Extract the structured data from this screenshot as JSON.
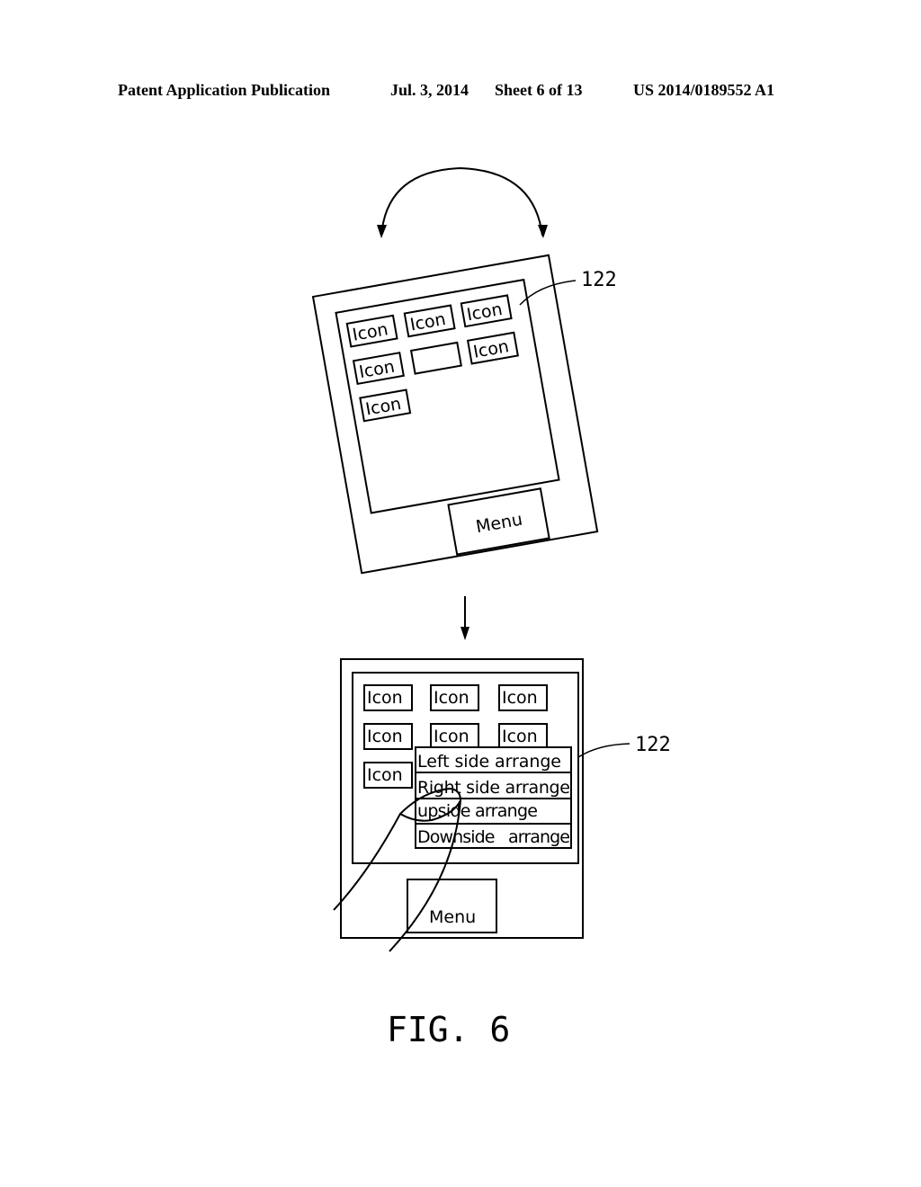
{
  "header": {
    "publication": "Patent Application Publication",
    "date": "Jul. 3, 2014",
    "sheet": "Sheet 6 of 13",
    "number": "US 2014/0189552 A1"
  },
  "figure": {
    "caption": "FIG. 6",
    "reference_label_top": "122",
    "reference_label_bottom": "122",
    "rotated_device": {
      "icons": [
        "Icon",
        "Icon",
        "Icon",
        "Icon",
        "Icon",
        "Icon"
      ],
      "menu_label": "Menu"
    },
    "upright_device": {
      "icons": [
        "Icon",
        "Icon",
        "Icon",
        "Icon",
        "Icon",
        "Icon",
        "Icon"
      ],
      "menu_label": "Menu",
      "arrange_menu": [
        "Left side arrange",
        "Right side arrange",
        "upside arrange",
        "Downside   arrange"
      ]
    }
  }
}
